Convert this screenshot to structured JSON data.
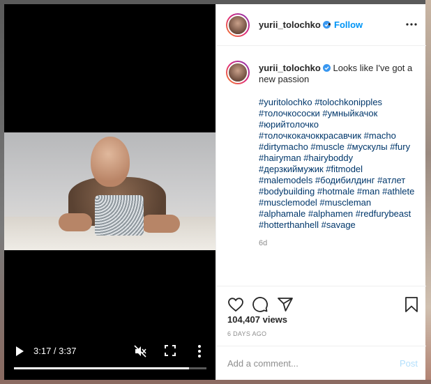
{
  "video": {
    "time_label": "3:17 / 3:37",
    "progress_fraction": 0.9078,
    "icons": [
      "play-icon",
      "muted-speaker-icon",
      "fullscreen-icon",
      "more-vertical-icon"
    ]
  },
  "header": {
    "username": "yurii_tolochko",
    "separator": "•",
    "follow_label": "Follow",
    "more_icon": "more-horizontal-icon"
  },
  "post": {
    "username": "yurii_tolochko",
    "caption": "Looks like I've got a new passion",
    "hashtags": "#yuritolochko #tolochkonipples #толочкососки #умныйкачок #юрийтолочко #толочкокачоккрасавчик #macho #dirtymacho #muscle #мускулы #fury #hairyman #hairyboddy #дерзкиймужик #fitmodel #malemodels #бодибилдинг #атлет #bodybuilding #hotmale #man #athlete #musclemodel #muscleman #alphamale #alphamen #redfurybeast #hotterthanhell #savage",
    "age": "6d"
  },
  "stats": {
    "views": "104,407 views",
    "date": "6 DAYS AGO"
  },
  "comment": {
    "placeholder": "Add a comment...",
    "post_label": "Post"
  },
  "colors": {
    "link": "#0095f6",
    "hashtag": "#00376b",
    "post_disabled": "#b2dffc",
    "muted_text": "#8e8e8e"
  }
}
